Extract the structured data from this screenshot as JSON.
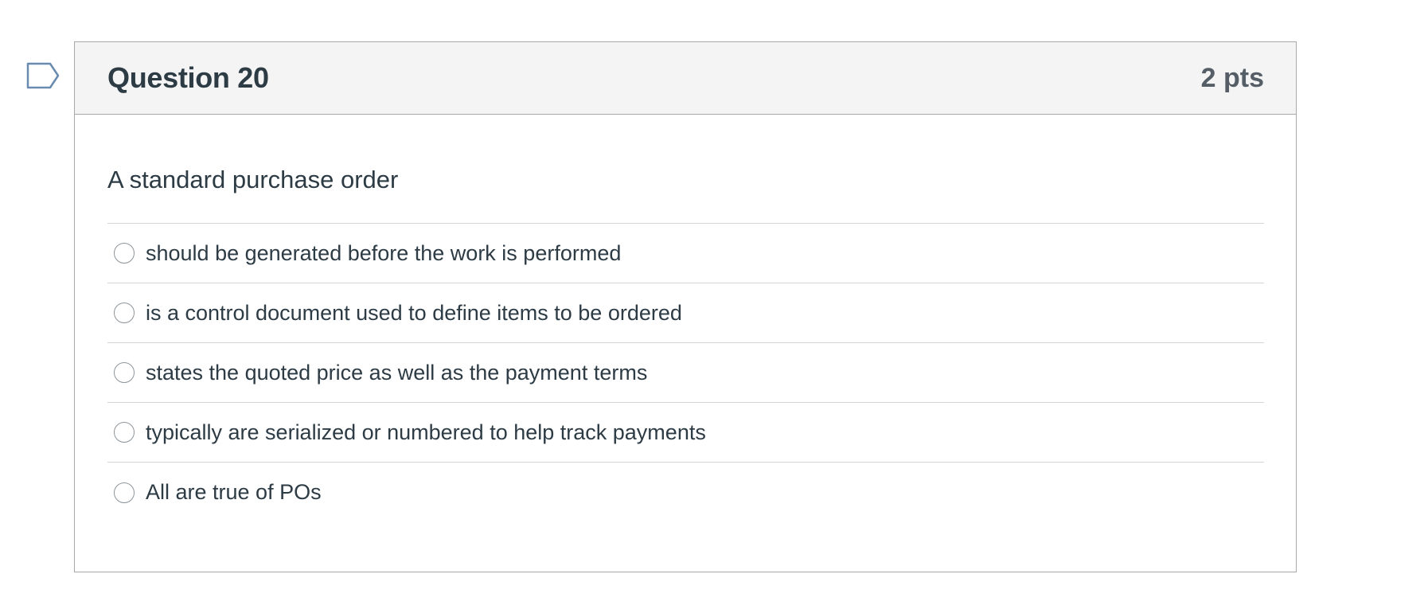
{
  "question": {
    "title": "Question 20",
    "points": "2 pts",
    "text": "A standard purchase order",
    "flag_icon": "bookmark-flag-icon",
    "answers": [
      {
        "label": "should be generated before the work is performed",
        "selected": false
      },
      {
        "label": "is a control document used to define items to be ordered",
        "selected": false
      },
      {
        "label": "states the quoted price as well as the payment terms",
        "selected": false
      },
      {
        "label": "typically are serialized or numbered to help track payments",
        "selected": false
      },
      {
        "label": "All are true of POs",
        "selected": false
      }
    ]
  },
  "colors": {
    "header_bg": "#f4f4f4",
    "border": "#a9a9a9",
    "text": "#2d3b45",
    "flag_stroke": "#6a8bb0"
  }
}
